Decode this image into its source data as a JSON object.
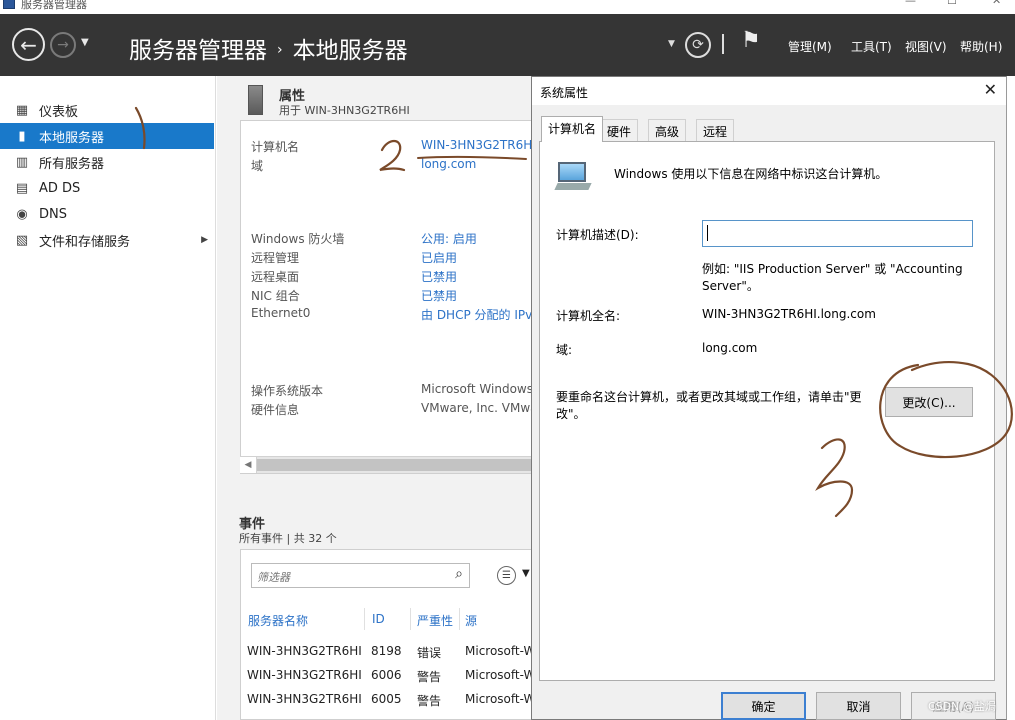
{
  "window": {
    "title": "服务器管理器",
    "controls": [
      "—",
      "☐",
      "✕"
    ]
  },
  "header": {
    "breadcrumb": [
      "服务器管理器",
      "本地服务器"
    ],
    "breadcrumb_separator": "›",
    "menus": [
      "管理(M)",
      "工具(T)",
      "视图(V)",
      "帮助(H)"
    ]
  },
  "sidebar": {
    "items": [
      {
        "label": "仪表板",
        "icon": "dashboard-icon",
        "active": false
      },
      {
        "label": "本地服务器",
        "icon": "local-server-icon",
        "active": true
      },
      {
        "label": "所有服务器",
        "icon": "all-servers-icon",
        "active": false
      },
      {
        "label": "AD DS",
        "icon": "ad-ds-icon",
        "active": false
      },
      {
        "label": "DNS",
        "icon": "dns-icon",
        "active": false
      },
      {
        "label": "文件和存储服务",
        "icon": "file-storage-icon",
        "active": false,
        "has_arrow": true
      }
    ]
  },
  "properties": {
    "title": "属性",
    "subtitle": "用于 WIN-3HN3G2TR6HI",
    "rows": [
      {
        "key": "计算机名",
        "value": "WIN-3HN3G2TR6HI",
        "link": true
      },
      {
        "key": "域",
        "value": "long.com",
        "link": true
      },
      {
        "key": "Windows 防火墙",
        "value": "公用: 启用",
        "link": true
      },
      {
        "key": "远程管理",
        "value": "已启用",
        "link": true
      },
      {
        "key": "远程桌面",
        "value": "已禁用",
        "link": true
      },
      {
        "key": "NIC 组合",
        "value": "已禁用",
        "link": true
      },
      {
        "key": "Ethernet0",
        "value": "由 DHCP 分配的 IPv",
        "link": true
      },
      {
        "key": "操作系统版本",
        "value": "Microsoft Windows",
        "link": false
      },
      {
        "key": "硬件信息",
        "value": "VMware, Inc. VMwa",
        "link": false
      }
    ]
  },
  "events": {
    "title": "事件",
    "subtitle": "所有事件 | 共 32 个",
    "filter_placeholder": "筛选器",
    "columns": [
      "服务器名称",
      "ID",
      "严重性",
      "源"
    ],
    "rows": [
      [
        "WIN-3HN3G2TR6HI",
        "8198",
        "错误",
        "Microsoft-W"
      ],
      [
        "WIN-3HN3G2TR6HI",
        "6006",
        "警告",
        "Microsoft-W"
      ],
      [
        "WIN-3HN3G2TR6HI",
        "6005",
        "警告",
        "Microsoft-W"
      ]
    ]
  },
  "dialog": {
    "title": "系统属性",
    "close": "✕",
    "tabs": [
      "计算机名",
      "硬件",
      "高级",
      "远程"
    ],
    "intro": "Windows 使用以下信息在网络中标识这台计算机。",
    "desc_label": "计算机描述(D):",
    "desc_value": "",
    "example_line1": "例如: \"IIS Production Server\" 或 \"Accounting",
    "example_line2": "Server\"。",
    "fullname_label": "计算机全名:",
    "fullname_value": "WIN-3HN3G2TR6HI.long.com",
    "domain_label": "域:",
    "domain_value": "long.com",
    "rename_line1": "要重命名这台计算机，或者更改其域或工作组，请单击\"更",
    "rename_line2": "改\"。",
    "change_button": "更改(C)...",
    "ok_button": "确定",
    "cancel_button": "取消",
    "apply_button": "应用(A)"
  },
  "watermark": "CSDN @盐焗",
  "annotations": {
    "color": "#7a4a2a",
    "marks": [
      "1",
      "2",
      "3"
    ]
  }
}
